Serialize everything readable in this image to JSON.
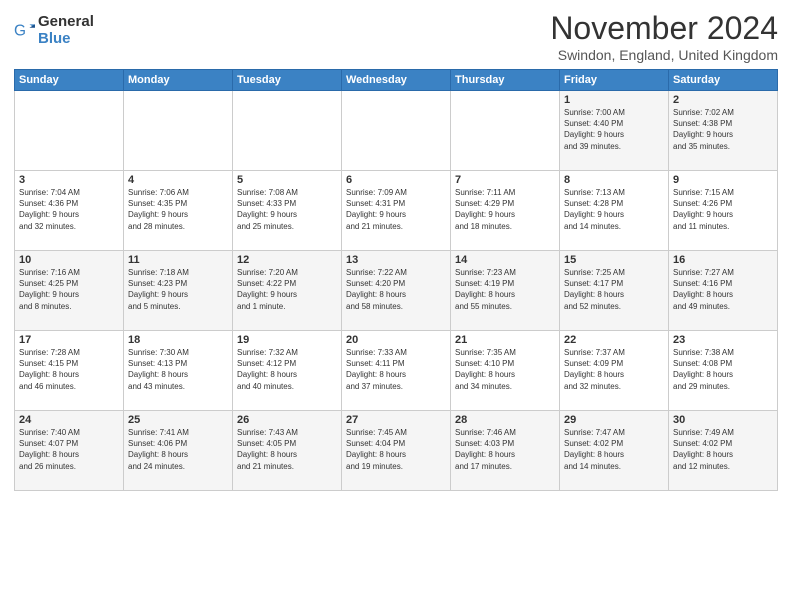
{
  "logo": {
    "general": "General",
    "blue": "Blue"
  },
  "title": "November 2024",
  "location": "Swindon, England, United Kingdom",
  "days_of_week": [
    "Sunday",
    "Monday",
    "Tuesday",
    "Wednesday",
    "Thursday",
    "Friday",
    "Saturday"
  ],
  "weeks": [
    [
      {
        "day": "",
        "info": ""
      },
      {
        "day": "",
        "info": ""
      },
      {
        "day": "",
        "info": ""
      },
      {
        "day": "",
        "info": ""
      },
      {
        "day": "",
        "info": ""
      },
      {
        "day": "1",
        "info": "Sunrise: 7:00 AM\nSunset: 4:40 PM\nDaylight: 9 hours\nand 39 minutes."
      },
      {
        "day": "2",
        "info": "Sunrise: 7:02 AM\nSunset: 4:38 PM\nDaylight: 9 hours\nand 35 minutes."
      }
    ],
    [
      {
        "day": "3",
        "info": "Sunrise: 7:04 AM\nSunset: 4:36 PM\nDaylight: 9 hours\nand 32 minutes."
      },
      {
        "day": "4",
        "info": "Sunrise: 7:06 AM\nSunset: 4:35 PM\nDaylight: 9 hours\nand 28 minutes."
      },
      {
        "day": "5",
        "info": "Sunrise: 7:08 AM\nSunset: 4:33 PM\nDaylight: 9 hours\nand 25 minutes."
      },
      {
        "day": "6",
        "info": "Sunrise: 7:09 AM\nSunset: 4:31 PM\nDaylight: 9 hours\nand 21 minutes."
      },
      {
        "day": "7",
        "info": "Sunrise: 7:11 AM\nSunset: 4:29 PM\nDaylight: 9 hours\nand 18 minutes."
      },
      {
        "day": "8",
        "info": "Sunrise: 7:13 AM\nSunset: 4:28 PM\nDaylight: 9 hours\nand 14 minutes."
      },
      {
        "day": "9",
        "info": "Sunrise: 7:15 AM\nSunset: 4:26 PM\nDaylight: 9 hours\nand 11 minutes."
      }
    ],
    [
      {
        "day": "10",
        "info": "Sunrise: 7:16 AM\nSunset: 4:25 PM\nDaylight: 9 hours\nand 8 minutes."
      },
      {
        "day": "11",
        "info": "Sunrise: 7:18 AM\nSunset: 4:23 PM\nDaylight: 9 hours\nand 5 minutes."
      },
      {
        "day": "12",
        "info": "Sunrise: 7:20 AM\nSunset: 4:22 PM\nDaylight: 9 hours\nand 1 minute."
      },
      {
        "day": "13",
        "info": "Sunrise: 7:22 AM\nSunset: 4:20 PM\nDaylight: 8 hours\nand 58 minutes."
      },
      {
        "day": "14",
        "info": "Sunrise: 7:23 AM\nSunset: 4:19 PM\nDaylight: 8 hours\nand 55 minutes."
      },
      {
        "day": "15",
        "info": "Sunrise: 7:25 AM\nSunset: 4:17 PM\nDaylight: 8 hours\nand 52 minutes."
      },
      {
        "day": "16",
        "info": "Sunrise: 7:27 AM\nSunset: 4:16 PM\nDaylight: 8 hours\nand 49 minutes."
      }
    ],
    [
      {
        "day": "17",
        "info": "Sunrise: 7:28 AM\nSunset: 4:15 PM\nDaylight: 8 hours\nand 46 minutes."
      },
      {
        "day": "18",
        "info": "Sunrise: 7:30 AM\nSunset: 4:13 PM\nDaylight: 8 hours\nand 43 minutes."
      },
      {
        "day": "19",
        "info": "Sunrise: 7:32 AM\nSunset: 4:12 PM\nDaylight: 8 hours\nand 40 minutes."
      },
      {
        "day": "20",
        "info": "Sunrise: 7:33 AM\nSunset: 4:11 PM\nDaylight: 8 hours\nand 37 minutes."
      },
      {
        "day": "21",
        "info": "Sunrise: 7:35 AM\nSunset: 4:10 PM\nDaylight: 8 hours\nand 34 minutes."
      },
      {
        "day": "22",
        "info": "Sunrise: 7:37 AM\nSunset: 4:09 PM\nDaylight: 8 hours\nand 32 minutes."
      },
      {
        "day": "23",
        "info": "Sunrise: 7:38 AM\nSunset: 4:08 PM\nDaylight: 8 hours\nand 29 minutes."
      }
    ],
    [
      {
        "day": "24",
        "info": "Sunrise: 7:40 AM\nSunset: 4:07 PM\nDaylight: 8 hours\nand 26 minutes."
      },
      {
        "day": "25",
        "info": "Sunrise: 7:41 AM\nSunset: 4:06 PM\nDaylight: 8 hours\nand 24 minutes."
      },
      {
        "day": "26",
        "info": "Sunrise: 7:43 AM\nSunset: 4:05 PM\nDaylight: 8 hours\nand 21 minutes."
      },
      {
        "day": "27",
        "info": "Sunrise: 7:45 AM\nSunset: 4:04 PM\nDaylight: 8 hours\nand 19 minutes."
      },
      {
        "day": "28",
        "info": "Sunrise: 7:46 AM\nSunset: 4:03 PM\nDaylight: 8 hours\nand 17 minutes."
      },
      {
        "day": "29",
        "info": "Sunrise: 7:47 AM\nSunset: 4:02 PM\nDaylight: 8 hours\nand 14 minutes."
      },
      {
        "day": "30",
        "info": "Sunrise: 7:49 AM\nSunset: 4:02 PM\nDaylight: 8 hours\nand 12 minutes."
      }
    ]
  ]
}
